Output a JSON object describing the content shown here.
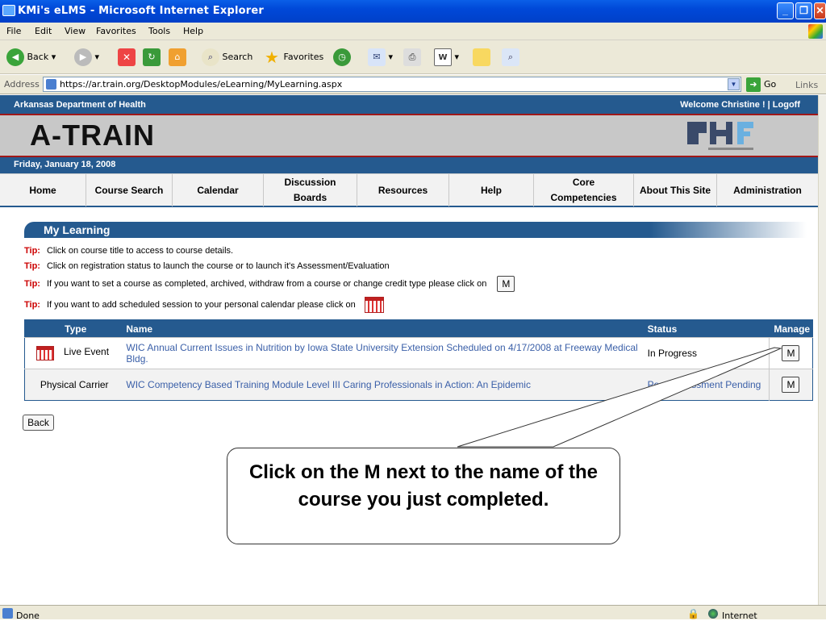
{
  "window": {
    "title": "KMi's eLMS - Microsoft Internet Explorer"
  },
  "menu": [
    "File",
    "Edit",
    "View",
    "Favorites",
    "Tools",
    "Help"
  ],
  "toolbar": {
    "back": "Back",
    "search": "Search",
    "favorites": "Favorites"
  },
  "address": {
    "label": "Address",
    "url": "https://ar.train.org/DesktopModules/eLearning/MyLearning.aspx",
    "go": "Go",
    "links": "Links"
  },
  "header": {
    "org": "Arkansas Department of Health",
    "welcome": "Welcome Christine ! | Logoff",
    "logo": "A-TRAIN",
    "date": "Friday, January 18, 2008"
  },
  "nav": [
    "Home",
    "Course Search",
    "Calendar",
    "Discussion Boards",
    "Resources",
    "Help",
    "Core Competencies",
    "About This Site",
    "Administration"
  ],
  "section": {
    "title": "My Learning"
  },
  "tips": {
    "label": "Tip:",
    "t1": "Click on course title to access to course details.",
    "t2": "Click on registration status to launch the course or to launch it's Assessment/Evaluation",
    "t3": "If you want to set a course as completed, archived, withdraw from a course or change credit type please click on",
    "t4": "If you want to add scheduled session to your personal calendar please click on",
    "m": "M"
  },
  "table": {
    "headers": {
      "type": "Type",
      "name": "Name",
      "status": "Status",
      "manage": "Manage"
    },
    "rows": [
      {
        "type": "Live Event",
        "name": "WIC Annual Current Issues in Nutrition by Iowa State University Extension Scheduled on 4/17/2008 at Freeway Medical Bldg.",
        "status": "In Progress",
        "manage": "M"
      },
      {
        "type": "Physical Carrier",
        "name": "WIC Competency Based Training Module Level III Caring Professionals in Action: An Epidemic",
        "status": "Post-Assessment Pending",
        "manage": "M"
      }
    ]
  },
  "back_label": "Back",
  "callout": "Click on the M next to the name of the course you just completed.",
  "status": {
    "done": "Done",
    "zone": "Internet"
  }
}
